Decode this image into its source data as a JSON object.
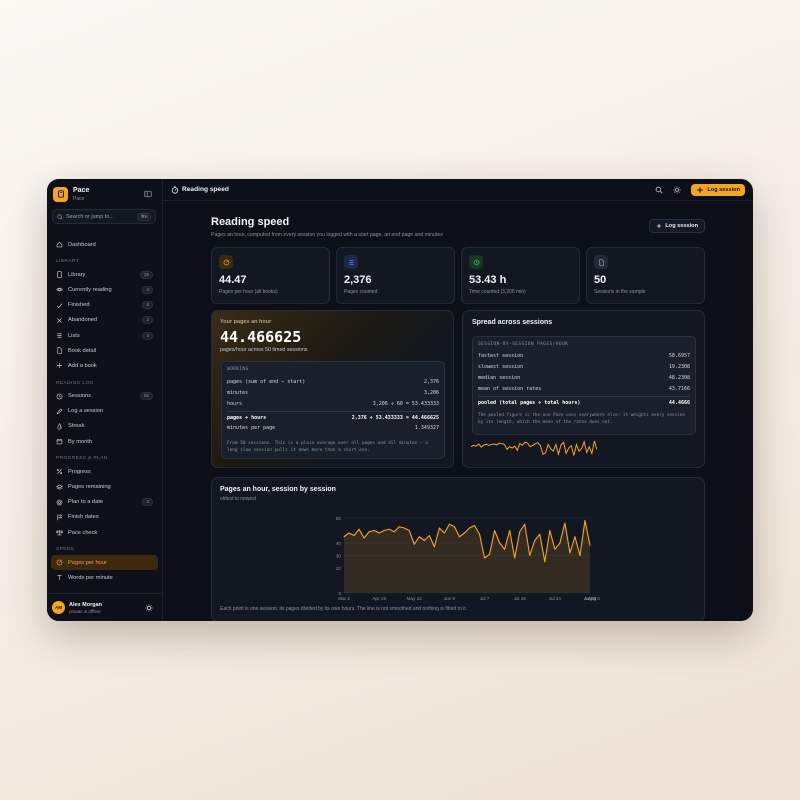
{
  "app": {
    "name": "Pace",
    "subtitle": "Pace"
  },
  "search": {
    "placeholder": "Search or jump to...",
    "shortcut": "⌘K"
  },
  "sidebar": {
    "sections": {
      "library": "LIBRARY",
      "reading_log": "READING LOG",
      "progress": "PROGRESS & PLAN",
      "speed": "SPEED"
    },
    "dashboard": "Dashboard",
    "library_items": [
      {
        "label": "Library",
        "count": "35"
      },
      {
        "label": "Currently reading",
        "count": "4"
      },
      {
        "label": "Finished",
        "count": "8"
      },
      {
        "label": "Abandoned",
        "count": "2"
      },
      {
        "label": "Lists",
        "count": "3"
      },
      {
        "label": "Book detail",
        "count": ""
      },
      {
        "label": "Add a book",
        "count": ""
      }
    ],
    "log_items": [
      {
        "label": "Sessions",
        "count": "50"
      },
      {
        "label": "Log a session",
        "count": ""
      },
      {
        "label": "Streak",
        "count": ""
      },
      {
        "label": "By month",
        "count": ""
      }
    ],
    "progress_items": [
      {
        "label": "Progress",
        "count": ""
      },
      {
        "label": "Pages remaining",
        "count": ""
      },
      {
        "label": "Plan to a date",
        "count": "3"
      },
      {
        "label": "Finish dates",
        "count": ""
      },
      {
        "label": "Pace check",
        "count": ""
      }
    ],
    "speed_items": [
      {
        "label": "Pages per hour",
        "count": ""
      },
      {
        "label": "Words per minute",
        "count": ""
      }
    ]
  },
  "user": {
    "initials": "AM",
    "name": "Alex Morgan",
    "status": "private & offline"
  },
  "topbar": {
    "title": "Reading speed",
    "log_button": "Log session"
  },
  "page": {
    "title": "Reading speed",
    "subtitle": "Pages an hour, computed from every session you logged with a start page, an end page and minutes",
    "log_button": "Log session"
  },
  "stats": [
    {
      "value": "44.47",
      "label": "Pages per hour (all books)",
      "icon": "gauge-icon",
      "color": "#f5a524"
    },
    {
      "value": "2,376",
      "label": "Pages counted",
      "icon": "list-icon",
      "color": "#5b8def"
    },
    {
      "value": "53.43 h",
      "label": "Time counted (3,206 min)",
      "icon": "clock-icon",
      "color": "#3fbf7a"
    },
    {
      "value": "50",
      "label": "Sessions in the sample",
      "icon": "file-icon",
      "color": "#9aa0ae"
    }
  ],
  "pph": {
    "kicker": "Your pages an hour",
    "value": "44.466625",
    "sub": "pages/hour across 50 timed sessions",
    "working_title": "WORKING",
    "rows": [
      {
        "label": "pages (sum of end − start)",
        "value": "2,376"
      },
      {
        "label": "minutes",
        "value": "3,206"
      },
      {
        "label": "hours",
        "value": "3,206 ÷ 60 = 53.433333"
      },
      {
        "label": "pages ÷ hours",
        "value": "2,376 ÷ 53.433333 = 44.466625"
      },
      {
        "label": "minutes per page",
        "value": "1.349327"
      }
    ],
    "note": "From 50 sessions. This is a plain average over all pages and all minutes — a long slow session pulls it down more than a short one."
  },
  "spread": {
    "title": "Spread across sessions",
    "box_title": "SESSION-BY-SESSION PAGES/HOUR",
    "rows": [
      {
        "label": "fastest session",
        "value": "58.6957"
      },
      {
        "label": "slowest session",
        "value": "19.2308"
      },
      {
        "label": "median session",
        "value": "48.2308"
      },
      {
        "label": "mean of session rates",
        "value": "43.7166"
      },
      {
        "label": "pooled (total pages ÷ total hours)",
        "value": "44.4666"
      }
    ],
    "note": "The pooled figure is the one Pace uses everywhere else: it weights every session by its length, which the mean of the rates does not."
  },
  "chart_card": {
    "title": "Pages an hour, session by session",
    "subtitle": "oldest to newest",
    "footnote": "Each point is one session: its pages divided by its own hours. The line is not smoothed and nothing is fitted to it."
  },
  "chart_data": {
    "type": "area",
    "title": "Pages an hour, session by session",
    "ylim": [
      0,
      60
    ],
    "y_ticks": [
      "0",
      "20",
      "30",
      "40",
      "60"
    ],
    "x_ticks": [
      "Mar 2",
      "Apr 19",
      "May 22",
      "Jun 9",
      "Jul 7",
      "Jul 15",
      "Jul 24",
      "Jul 30",
      "Aug 4",
      "Aug 6"
    ],
    "color": "#f5a524",
    "values": [
      45,
      48,
      46,
      51,
      44,
      49,
      50,
      48,
      50,
      51,
      49,
      53,
      52,
      50,
      39,
      45,
      42,
      46,
      37,
      52,
      48,
      55,
      53,
      45,
      48,
      52,
      54,
      47,
      28,
      31,
      50,
      40,
      35,
      50,
      28,
      49,
      55,
      30,
      42,
      47,
      25,
      50,
      35,
      40,
      56,
      32,
      45,
      30,
      58,
      38
    ]
  }
}
